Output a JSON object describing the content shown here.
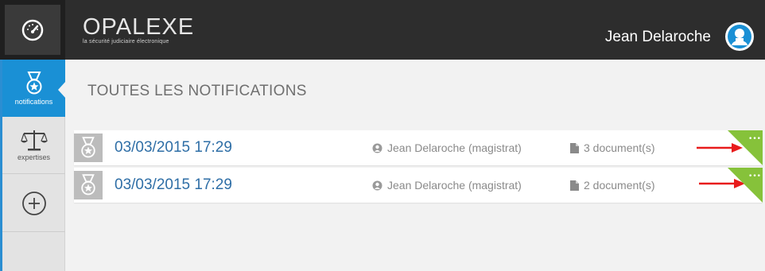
{
  "header": {
    "brand_title": "OPALEXE",
    "brand_subtitle": "la sécurité judiciaire électronique",
    "user_name": "Jean Delaroche"
  },
  "sidebar": {
    "items": [
      {
        "label": "notifications",
        "icon": "award-icon",
        "active": true
      },
      {
        "label": "expertises",
        "icon": "scales-icon",
        "active": false
      },
      {
        "label": "",
        "icon": "plus-circle-icon",
        "active": false
      }
    ]
  },
  "main": {
    "title": "TOUTES LES NOTIFICATIONS",
    "notifications": [
      {
        "date": "03/03/2015 17:29",
        "user": "Jean Delaroche (magistrat)",
        "documents": "3 document(s)",
        "more": "•••"
      },
      {
        "date": "03/03/2015 17:29",
        "user": "Jean Delaroche (magistrat)",
        "documents": "2 document(s)",
        "more": "•••"
      }
    ]
  },
  "colors": {
    "accent_blue": "#1a90d5",
    "corner_green": "#86c23a",
    "arrow_red": "#e81c1c",
    "date_blue": "#2e6ea6"
  }
}
